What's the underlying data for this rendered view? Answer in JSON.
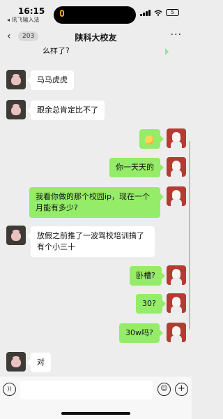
{
  "status_bar": {
    "time": "16:15",
    "sub_label": "◂ 讯飞输入法",
    "battery": "5"
  },
  "header": {
    "back_icon": "‹",
    "unread_count": "203",
    "title": "陕科大校友",
    "more_icon": "···"
  },
  "messages": [
    {
      "side": "right",
      "text": "么样了?"
    },
    {
      "side": "left",
      "text": "马马虎虎"
    },
    {
      "side": "left",
      "text": "跟余总肯定比不了"
    },
    {
      "side": "right",
      "text": "[emoji]"
    },
    {
      "side": "right",
      "text": "你一天天的"
    },
    {
      "side": "right",
      "text": "我看你做的那个校园ip，现在一个月能有多少?"
    },
    {
      "side": "left",
      "text": "放假之前推了一波驾校培训搞了有个小三十"
    },
    {
      "side": "right",
      "text": "卧槽?"
    },
    {
      "side": "right",
      "text": "30?"
    },
    {
      "side": "right",
      "text": "30w吗?"
    },
    {
      "side": "left",
      "text": "对"
    }
  ],
  "input_bar": {
    "voice_icon": "))",
    "emoji_icon": "☺",
    "plus_icon": "+"
  }
}
